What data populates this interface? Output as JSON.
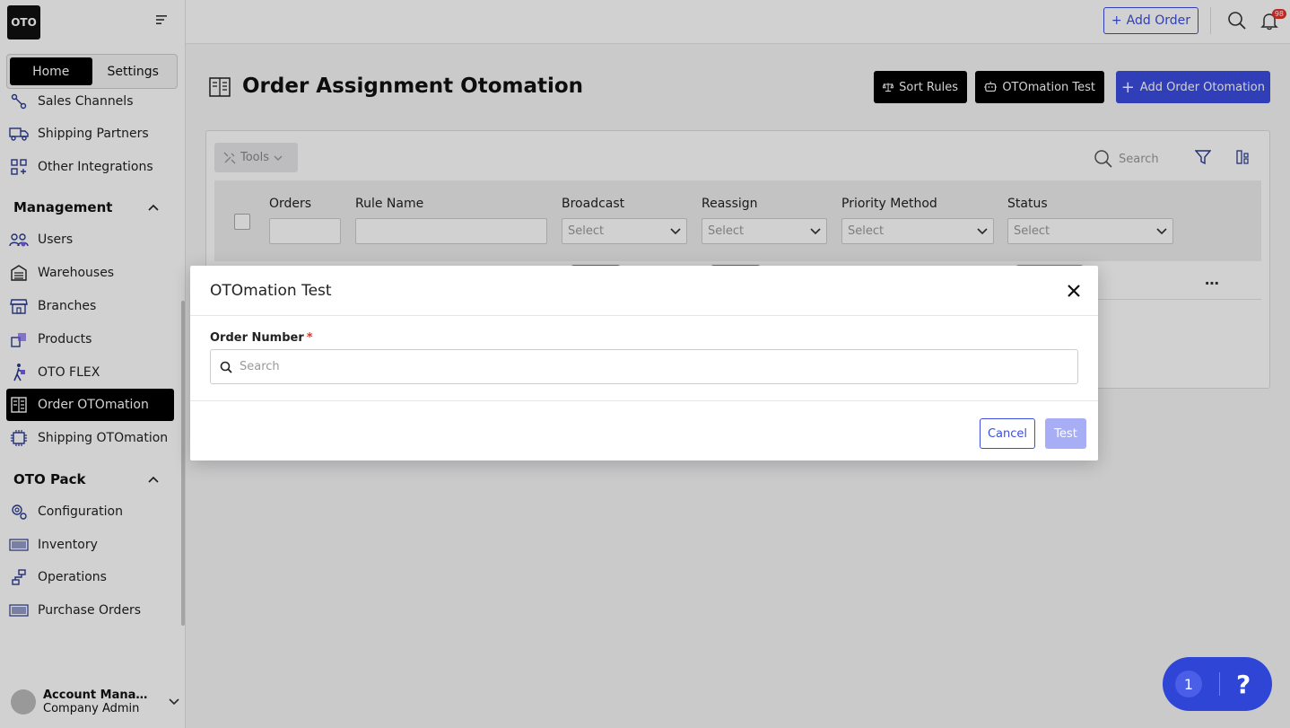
{
  "app": {
    "logo": "OTO"
  },
  "sidebar": {
    "tabs": {
      "home": "Home",
      "settings": "Settings"
    },
    "items_top": [
      {
        "label": "Sales Channels",
        "icon": "sales-channels-icon"
      },
      {
        "label": "Shipping Partners",
        "icon": "truck-icon"
      },
      {
        "label": "Other Integrations",
        "icon": "grid-plus-icon"
      }
    ],
    "management": {
      "title": "Management",
      "items": [
        {
          "label": "Users",
          "icon": "users-icon"
        },
        {
          "label": "Warehouses",
          "icon": "warehouse-icon"
        },
        {
          "label": "Branches",
          "icon": "store-icon"
        },
        {
          "label": "Products",
          "icon": "products-icon"
        },
        {
          "label": "OTO FLEX",
          "icon": "walker-icon"
        },
        {
          "label": "Order OTOmation",
          "icon": "order-automation-icon"
        },
        {
          "label": "Shipping OTOmation",
          "icon": "chip-icon"
        }
      ]
    },
    "pack": {
      "title": "OTO Pack",
      "items": [
        {
          "label": "Configuration",
          "icon": "gear-icon"
        },
        {
          "label": "Inventory",
          "icon": "barcode-icon"
        },
        {
          "label": "Operations",
          "icon": "flow-icon"
        },
        {
          "label": "Purchase Orders",
          "icon": "barcode-icon"
        }
      ]
    },
    "account": {
      "name": "Account Manage...",
      "role": "Company Admin"
    }
  },
  "topbar": {
    "add_order": "Add Order",
    "notification_count": "98"
  },
  "page": {
    "title": "Order Assignment Otomation",
    "sort_rules": "Sort Rules",
    "otomation_test": "OTOmation Test",
    "add_order_otomation": "Add Order Otomation",
    "tools": "Tools",
    "search_placeholder": "Search",
    "columns": {
      "orders": "Orders",
      "rule_name": "Rule Name",
      "broadcast": "Broadcast",
      "reassign": "Reassign",
      "priority_method": "Priority Method",
      "status": "Status"
    },
    "select_placeholder": "Select"
  },
  "modal": {
    "title": "OTOmation Test",
    "field_label": "Order Number",
    "required_mark": "*",
    "search_placeholder": "Search",
    "cancel": "Cancel",
    "test": "Test"
  },
  "help": {
    "count": "1",
    "symbol": "?"
  }
}
